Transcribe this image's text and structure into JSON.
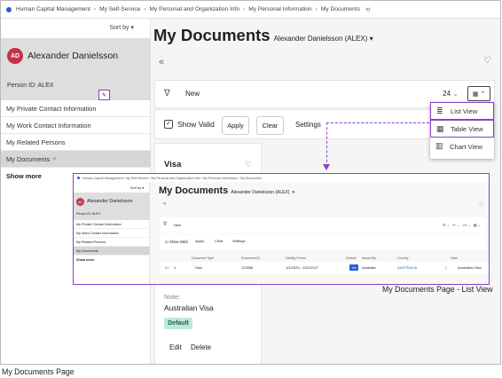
{
  "breadcrumb": [
    "Human Capital Management",
    "My Self-Service",
    "My Personal and Organization Info",
    "My Personal Information",
    "My Documents"
  ],
  "sidebar": {
    "sort_by": "Sort by",
    "avatar_initials": "AD",
    "name": "Alexander Danielsson",
    "person_id": "Person ID:  ALEX",
    "items": [
      "My Private Contact Information",
      "My Work Contact Information",
      "My Related Persons",
      "My Documents"
    ],
    "show_more": "Show more"
  },
  "main": {
    "title": "My Documents",
    "subtitle": "Alexander Danielsson (ALEX)",
    "new_label": "New",
    "count": "24",
    "show_valid": "Show Valid",
    "apply": "Apply",
    "clear": "Clear",
    "settings": "Settings"
  },
  "view_menu": [
    "List View",
    "Table View",
    "Chart View"
  ],
  "card": {
    "title": "Visa",
    "note_label": "Note:",
    "note_value": "Australian Visa",
    "default_badge": "Default",
    "edit": "Edit",
    "delete": "Delete"
  },
  "inset": {
    "columns": [
      "Document Type",
      "Document ID",
      "Validity Period",
      "Default",
      "Issued By",
      "Country",
      "Note"
    ],
    "row": {
      "index": "1",
      "type": "Visa",
      "id": "123456",
      "validity": "1/1/2020 - 12/1/2027",
      "default": "Yes",
      "issued_by": "Australia",
      "country": "AUSTRALIA",
      "note": "Australian Visa"
    }
  },
  "captions": {
    "list_view": "My Documents Page - List View",
    "page": "My Documents Page"
  },
  "colors": {
    "accent": "#8a3fc8",
    "avatar": "#c4314b",
    "brand": "#2a5bd7",
    "default_badge": "#bfe9db"
  }
}
